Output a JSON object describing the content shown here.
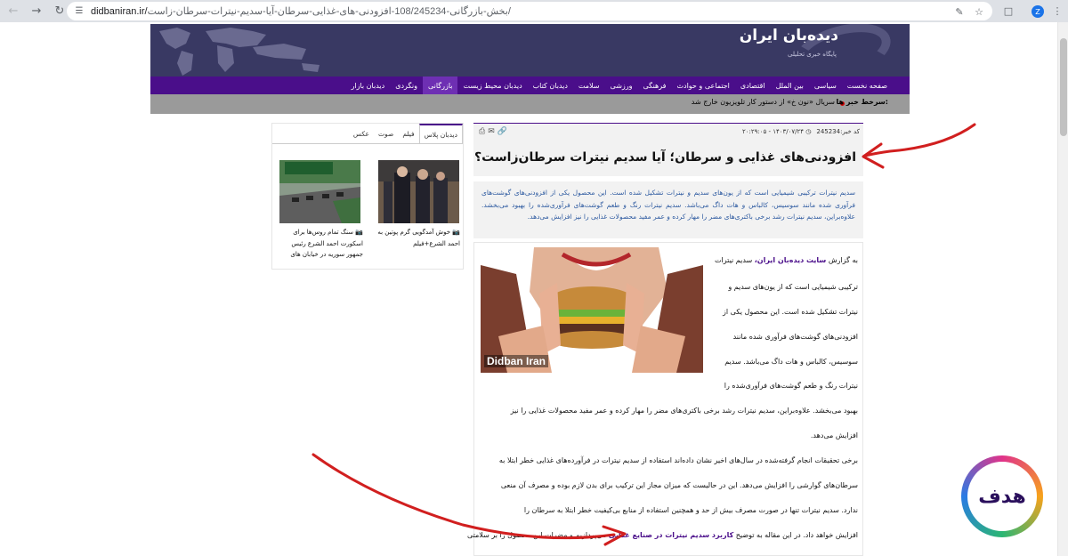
{
  "browser": {
    "url_domain": "didbaniran.ir/",
    "url_path": "بخش-بازرگانی-108/245234-افزودنی-های-غذایی-سرطان-آیا-سدیم-نیترات-سرطان-زاست/",
    "profile_initial": "Z"
  },
  "site": {
    "logo_text": "دیده‌بان ایران",
    "logo_sub": "پایگاه خبری تحلیلی"
  },
  "menu": {
    "items": [
      "صفحه نخست",
      "سیاسی",
      "بین الملل",
      "اقتصادی",
      "اجتماعی و حوادث",
      "فرهنگی",
      "ورزشی",
      "سلامت",
      "دیدبان کتاب",
      "دیدبان محیط زیست",
      "بازرگانی",
      "ونگردی",
      "دیدبان بازار"
    ],
    "active_index": 10
  },
  "ticker": {
    "label": "سرخط خبر ها:",
    "text": "سریال «نون خ» از دستور کار تلویزیون خارج شد"
  },
  "article": {
    "code_label": "کد خبر:",
    "code": "245234",
    "date": "۱۴۰۳/۰۷/۲۴ - ۲۰:۲۹:۰۵",
    "title": "افزودنی‌های غذایی و سرطان؛ آیا سدیم نیترات سرطان‌زاست؟",
    "lead": "سدیم نیترات ترکیبی شیمیایی است که از یون‌های سدیم و نیترات تشکیل شده است. این محصول یکی از افزودنی‌های گوشت‌های فرآوری شده مانند سوسیس، کالباس و هات داگ می‌باشد. سدیم نیترات رنگ و طعم گوشت‌های فرآوری‌شده را بهبود می‌بخشد. علاوه‌براین، سدیم نیترات رشد برخی باکتری‌های مضر را مهار کرده و عمر مفید محصولات غذایی را نیز افزایش می‌دهد.",
    "hero_watermark": "Didban Iran",
    "p1_prefix": "به گزارش ",
    "p1_link": "سایت دیده‌بان ایران،",
    "p1_suffix": " سدیم نیترات",
    "narrow_lines": [
      "ترکیبی شیمیایی است که از یون‌های سدیم و",
      "نیترات تشکیل شده است. این محصول یکی از",
      "افزودنی‌های گوشت‌های فرآوری شده مانند",
      "سوسیس، کالباس و هات داگ می‌باشد. سدیم",
      "نیترات رنگ و طعم گوشت‌های فرآوری‌شده را"
    ],
    "wide_lines": [
      "بهبود می‌بخشد. علاوه‌براین، سدیم نیترات رشد برخی باکتری‌های مضر را مهار کرده و عمر مفید محصولات غذایی را نیز",
      "افزایش می‌دهد.",
      "برخی تحقیقات انجام گرفته‌شده در سال‌های اخیر نشان داده‌اند استفاده از سدیم نیترات در فرآورده‌های غذایی خطر ابتلا به",
      "سرطان‌های گوارشی را افزایش می‌دهد. این در حالیست که میزان مجاز این ترکیب برای بدن لازم بوده و مصرف آن منعی",
      "ندارد. سدیم نیترات تنها در صورت مصرف بیش از حد و همچنین استفاده از منابع بی‌کیفیت خطر ابتلا به سرطان را"
    ],
    "last_prefix": "افزایش خواهد داد. در این مقاله به توضیح ",
    "last_link": "کاربرد سدیم نیترات در صنایع غذایی",
    "last_suffix": " می‌پردازیم و مضرات این محصول را بر سلامتی"
  },
  "sidebar": {
    "tabs": [
      "دیدبان پلاس",
      "فیلم",
      "صوت",
      "عکس"
    ],
    "items": [
      {
        "caption": "خوش آمدگویی گرم پوتین به احمد الشرع+فیلم"
      },
      {
        "caption": "سنگ تمام روس‌ها برای اسکورت احمد الشرع رئیس جمهور سوریه در خیابان های"
      }
    ]
  },
  "badge": {
    "text": "هدف"
  },
  "colors": {
    "brand_purple": "#4a0e8a",
    "banner": "#393963",
    "ticker_bg": "#9a9a9a",
    "annotation_red": "#d11f1f"
  }
}
